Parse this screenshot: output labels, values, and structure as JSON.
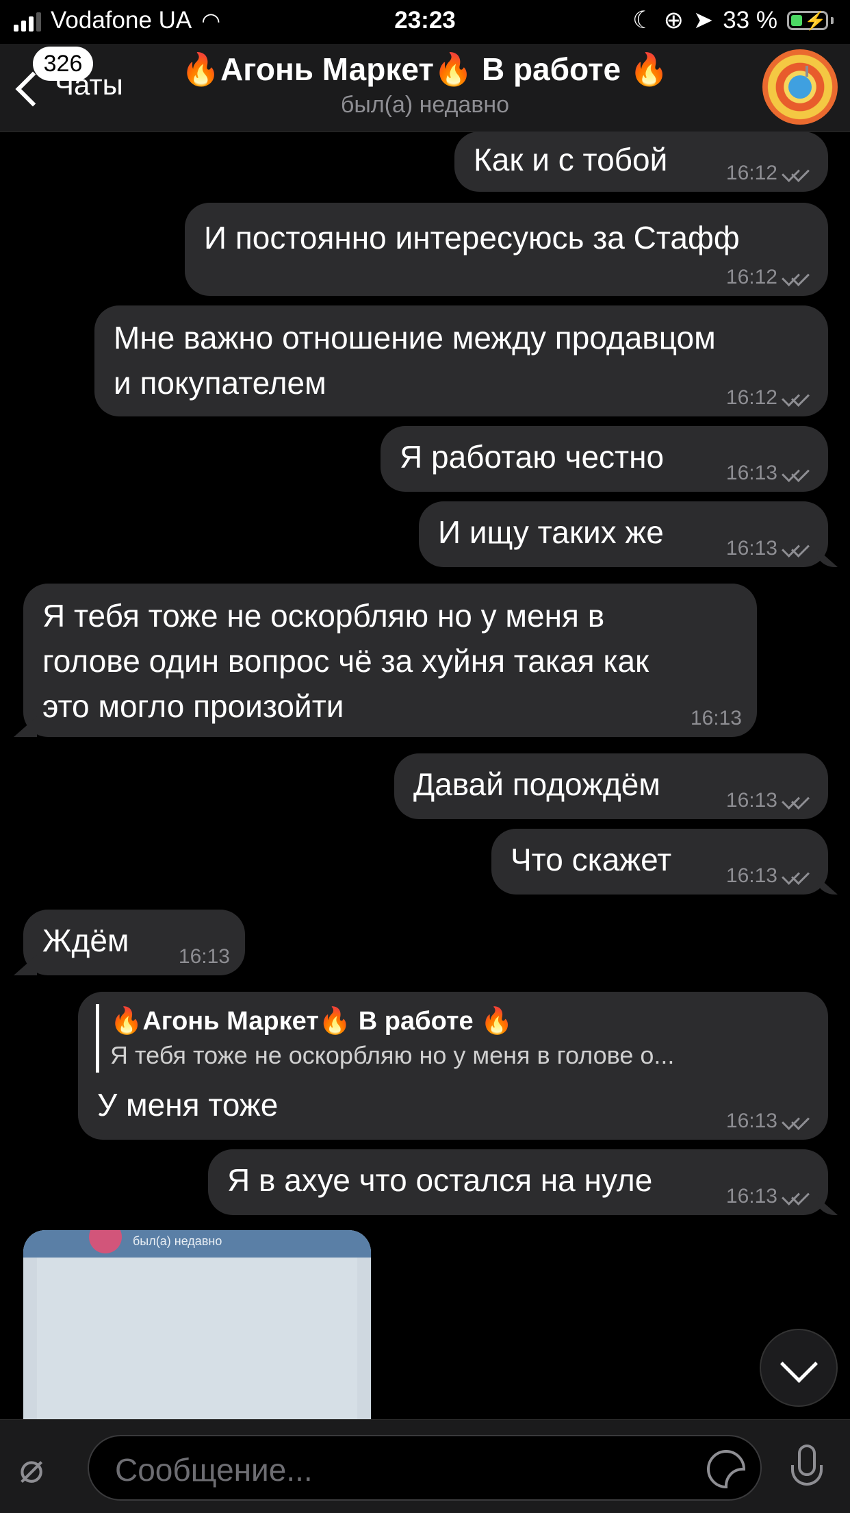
{
  "status_bar": {
    "carrier": "Vodafone UA",
    "time": "23:23",
    "battery": "33 %",
    "battery_level": 0.33
  },
  "header": {
    "back_label": "Чаты",
    "unread_badge": "326",
    "title": "🔥Агонь Маркет🔥 В работе 🔥",
    "subtitle": "был(а) недавно"
  },
  "messages": [
    {
      "dir": "out",
      "text": "Как и с тобой",
      "time": "16:12"
    },
    {
      "dir": "out",
      "text": "И постоянно интересуюсь за Стафф",
      "time": "16:12"
    },
    {
      "dir": "out",
      "lines": [
        "Мне важно отношение между продавцом",
        "и покупателем"
      ],
      "time": "16:12"
    },
    {
      "dir": "out",
      "text": "Я работаю честно",
      "time": "16:13"
    },
    {
      "dir": "out",
      "text": "И ищу таких же",
      "time": "16:13"
    },
    {
      "dir": "in",
      "lines": [
        "Я тебя тоже не оскорбляю но у меня в",
        "голове один вопрос чё за хуйня такая как",
        "это могло произойти"
      ],
      "time": "16:13"
    },
    {
      "dir": "out",
      "text": "Давай подождём",
      "time": "16:13"
    },
    {
      "dir": "out",
      "text": "Что скажет",
      "time": "16:13"
    },
    {
      "dir": "in",
      "text": "Ждём",
      "time": "16:13"
    },
    {
      "dir": "out",
      "reply_name": "🔥Агонь Маркет🔥 В работе 🔥",
      "reply_text": "Я тебя тоже не оскорбляю но у меня в голове о...",
      "text": "У меня тоже",
      "time": "16:13"
    },
    {
      "dir": "out",
      "text": "Я в ахуе что остался на нуле",
      "time": "16:13"
    }
  ],
  "photo": {
    "inner_subtitle": "был(а) недавно"
  },
  "input": {
    "placeholder": "Сообщение..."
  },
  "icons": {
    "attach": "paperclip-icon",
    "sticker": "sticker-icon",
    "mic": "microphone-icon",
    "scroll": "chevron-down-icon",
    "back": "chevron-left-icon"
  }
}
